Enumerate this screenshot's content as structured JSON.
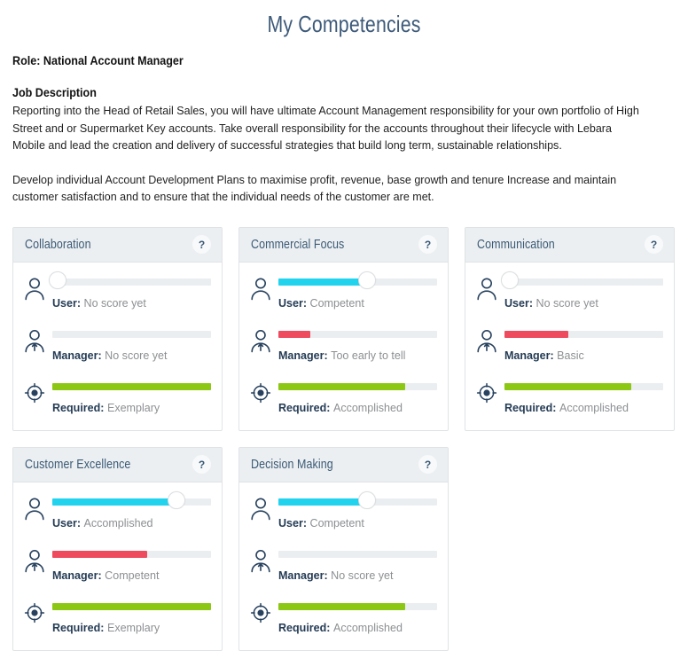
{
  "page": {
    "title": "My Competencies",
    "role_label": "Role:",
    "role_value": "National Account Manager",
    "job_description_heading": "Job Description",
    "job_description_paragraph_1": "Reporting into the Head of Retail Sales, you will have ultimate Account Management responsibility for your own portfolio of High Street and or Supermarket Key accounts. Take overall responsibility for the accounts throughout their lifecycle with Lebara Mobile and lead the creation and delivery of successful strategies that build long term, sustainable relationships.",
    "job_description_paragraph_2": "Develop individual Account Development Plans to maximise profit, revenue, base growth and tenure Increase and maintain customer satisfaction and to ensure that the individual needs of the customer are met."
  },
  "colors": {
    "title": "#3d5a7a",
    "card_header_bg": "#eceff1",
    "card_border": "#dfe3e6",
    "track": "#ebeef0",
    "user_fill": "#22d3ee",
    "manager_fill": "#ef4b5e",
    "required_fill": "#8cc714",
    "label": "#253c55",
    "value": "#8c8f92"
  },
  "labels": {
    "user": "User:",
    "manager": "Manager:",
    "required": "Required:",
    "help": "?"
  },
  "icons": {
    "user": "person-icon",
    "manager": "manager-person-arrow-icon",
    "required": "target-icon",
    "help": "question-mark-icon"
  },
  "competencies": [
    {
      "title": "Collaboration",
      "user": {
        "value": "No score yet",
        "percent": 0
      },
      "manager": {
        "value": "No score yet",
        "percent": 0
      },
      "required": {
        "value": "Exemplary",
        "percent": 100
      }
    },
    {
      "title": "Commercial Focus",
      "user": {
        "value": "Competent",
        "percent": 56
      },
      "manager": {
        "value": "Too early to tell",
        "percent": 20
      },
      "required": {
        "value": "Accomplished",
        "percent": 80
      }
    },
    {
      "title": "Communication",
      "user": {
        "value": "No score yet",
        "percent": 0
      },
      "manager": {
        "value": "Basic",
        "percent": 40
      },
      "required": {
        "value": "Accomplished",
        "percent": 80
      }
    },
    {
      "title": "Customer Excellence",
      "user": {
        "value": "Accomplished",
        "percent": 78
      },
      "manager": {
        "value": "Competent",
        "percent": 60
      },
      "required": {
        "value": "Exemplary",
        "percent": 100
      }
    },
    {
      "title": "Decision Making",
      "user": {
        "value": "Competent",
        "percent": 56
      },
      "manager": {
        "value": "No score yet",
        "percent": 0
      },
      "required": {
        "value": "Accomplished",
        "percent": 80
      }
    }
  ]
}
